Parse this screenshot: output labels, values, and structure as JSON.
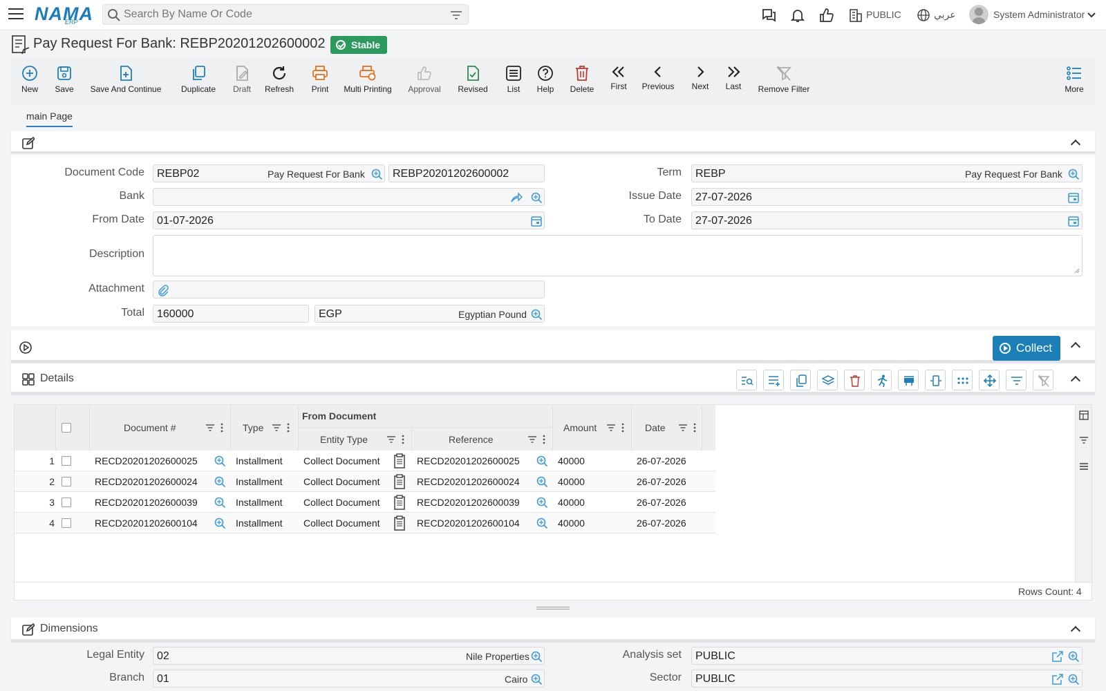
{
  "topbar": {
    "logo": "NAMA",
    "logo_sub": "ERP",
    "search_placeholder": "Search By Name Or Code",
    "branch": "PUBLIC",
    "language": "عربي",
    "user": "System Administrator"
  },
  "header": {
    "title": "Pay Request For Bank: REBP20201202600002",
    "status": "Stable"
  },
  "toolbar": {
    "new": "New",
    "save": "Save",
    "save_continue": "Save And Continue",
    "duplicate": "Duplicate",
    "draft": "Draft",
    "refresh": "Refresh",
    "print": "Print",
    "multi_printing": "Multi Printing",
    "approval": "Approval",
    "revised": "Revised",
    "list": "List",
    "help": "Help",
    "delete": "Delete",
    "first": "First",
    "previous": "Previous",
    "next": "Next",
    "last": "Last",
    "remove_filter": "Remove Filter",
    "more": "More"
  },
  "tabs": {
    "main": "main Page"
  },
  "form": {
    "document_code_label": "Document Code",
    "document_code": "REBP02",
    "document_code_desc": "Pay Request For Bank",
    "document_number": "REBP20201202600002",
    "term_label": "Term",
    "term": "REBP",
    "term_desc": "Pay Request For Bank",
    "bank_label": "Bank",
    "bank": "",
    "issue_date_label": "Issue Date",
    "issue_date": "27-07-2026",
    "from_date_label": "From Date",
    "from_date": "01-07-2026",
    "to_date_label": "To Date",
    "to_date": "27-07-2026",
    "description_label": "Description",
    "description": "",
    "attachment_label": "Attachment",
    "total_label": "Total",
    "total": "160000",
    "currency": "EGP",
    "currency_desc": "Egyptian Pound"
  },
  "actions": {
    "collect": "Collect"
  },
  "details": {
    "title": "Details",
    "columns": {
      "document_no": "Document #",
      "type": "Type",
      "from_document": "From Document",
      "entity_type": "Entity Type",
      "reference": "Reference",
      "amount": "Amount",
      "date": "Date"
    },
    "rows": [
      {
        "n": "1",
        "doc": "RECD20201202600025",
        "type": "Installment",
        "entity": "Collect Document",
        "ref": "RECD20201202600025",
        "amount": "40000",
        "date": "26-07-2026"
      },
      {
        "n": "2",
        "doc": "RECD20201202600024",
        "type": "Installment",
        "entity": "Collect Document",
        "ref": "RECD20201202600024",
        "amount": "40000",
        "date": "26-07-2026"
      },
      {
        "n": "3",
        "doc": "RECD20201202600039",
        "type": "Installment",
        "entity": "Collect Document",
        "ref": "RECD20201202600039",
        "amount": "40000",
        "date": "26-07-2026"
      },
      {
        "n": "4",
        "doc": "RECD20201202600104",
        "type": "Installment",
        "entity": "Collect Document",
        "ref": "RECD20201202600104",
        "amount": "40000",
        "date": "26-07-2026"
      }
    ],
    "rows_count": "Rows Count: 4"
  },
  "dimensions": {
    "title": "Dimensions",
    "legal_entity_label": "Legal Entity",
    "legal_entity": "02",
    "legal_entity_desc": "Nile Properties",
    "analysis_set_label": "Analysis set",
    "analysis_set": "PUBLIC",
    "branch_label": "Branch",
    "branch": "01",
    "branch_desc": "Cairo",
    "sector_label": "Sector",
    "sector": "PUBLIC"
  },
  "colors": {
    "accent": "#1c7fb7",
    "stable": "#2c9a5c",
    "print_orange": "#e8711c",
    "delete_red": "#c0392b",
    "revised_green": "#2c8a4a"
  }
}
